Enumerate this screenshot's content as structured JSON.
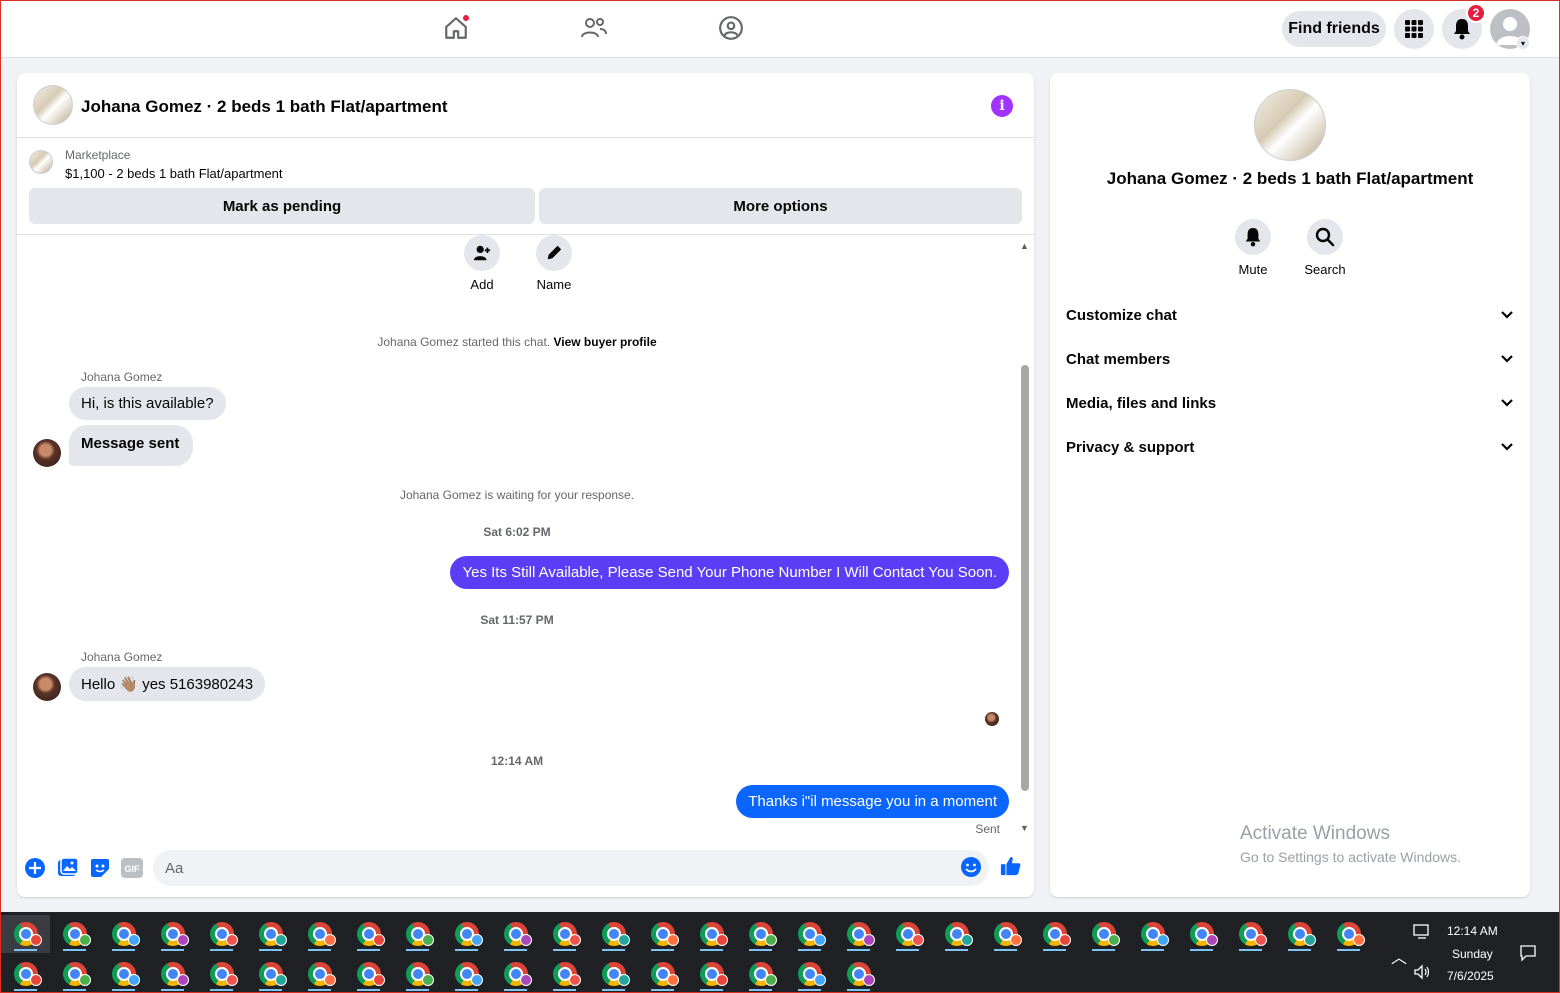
{
  "topnav": {
    "find_friends_label": "Find friends",
    "notification_count": "2"
  },
  "chat": {
    "title": "Johana Gomez · 2 beds 1 bath Flat/apartment",
    "marketplace_label": "Marketplace",
    "listing_price": "$1,100 - 2 beds 1 bath Flat/apartment",
    "mark_pending_label": "Mark as pending",
    "more_options_label": "More options",
    "add_label": "Add",
    "name_label": "Name",
    "started_text": "Johana Gomez started this chat.",
    "view_buyer_profile": "View buyer profile",
    "messages": {
      "sender_1": "Johana Gomez",
      "in_1": "Hi, is this available?",
      "in_2": "Message sent",
      "waiting_text": "Johana Gomez is waiting for your response.",
      "time_1": "Sat 6:02 PM",
      "out_1": "Yes Its Still Available, Please Send Your Phone Number I Will Contact You Soon.",
      "time_2": "Sat 11:57 PM",
      "sender_2": "Johana Gomez",
      "in_3": "Hello 👋🏽 yes 5163980243",
      "time_3": "12:14 AM",
      "out_2": "Thanks i\"il message you in a moment",
      "sent_status": "Sent"
    },
    "composer_placeholder": "Aa",
    "gif_label": "GIF"
  },
  "info": {
    "name": "Johana Gomez · 2 beds 1 bath Flat/apartment",
    "mute_label": "Mute",
    "search_label": "Search",
    "sections": [
      "Customize chat",
      "Chat members",
      "Media, files and links",
      "Privacy & support"
    ]
  },
  "watermark": {
    "line1": "Activate Windows",
    "line2": "Go to Settings to activate Windows."
  },
  "taskbar": {
    "time": "12:14 AM",
    "day": "Sunday",
    "date": "7/6/2025"
  },
  "colors": {
    "accent_purple": "#5b3df5",
    "accent_blue": "#0a66ff",
    "info_purple": "#a033ff",
    "messenger_blue": "#0866ff"
  }
}
